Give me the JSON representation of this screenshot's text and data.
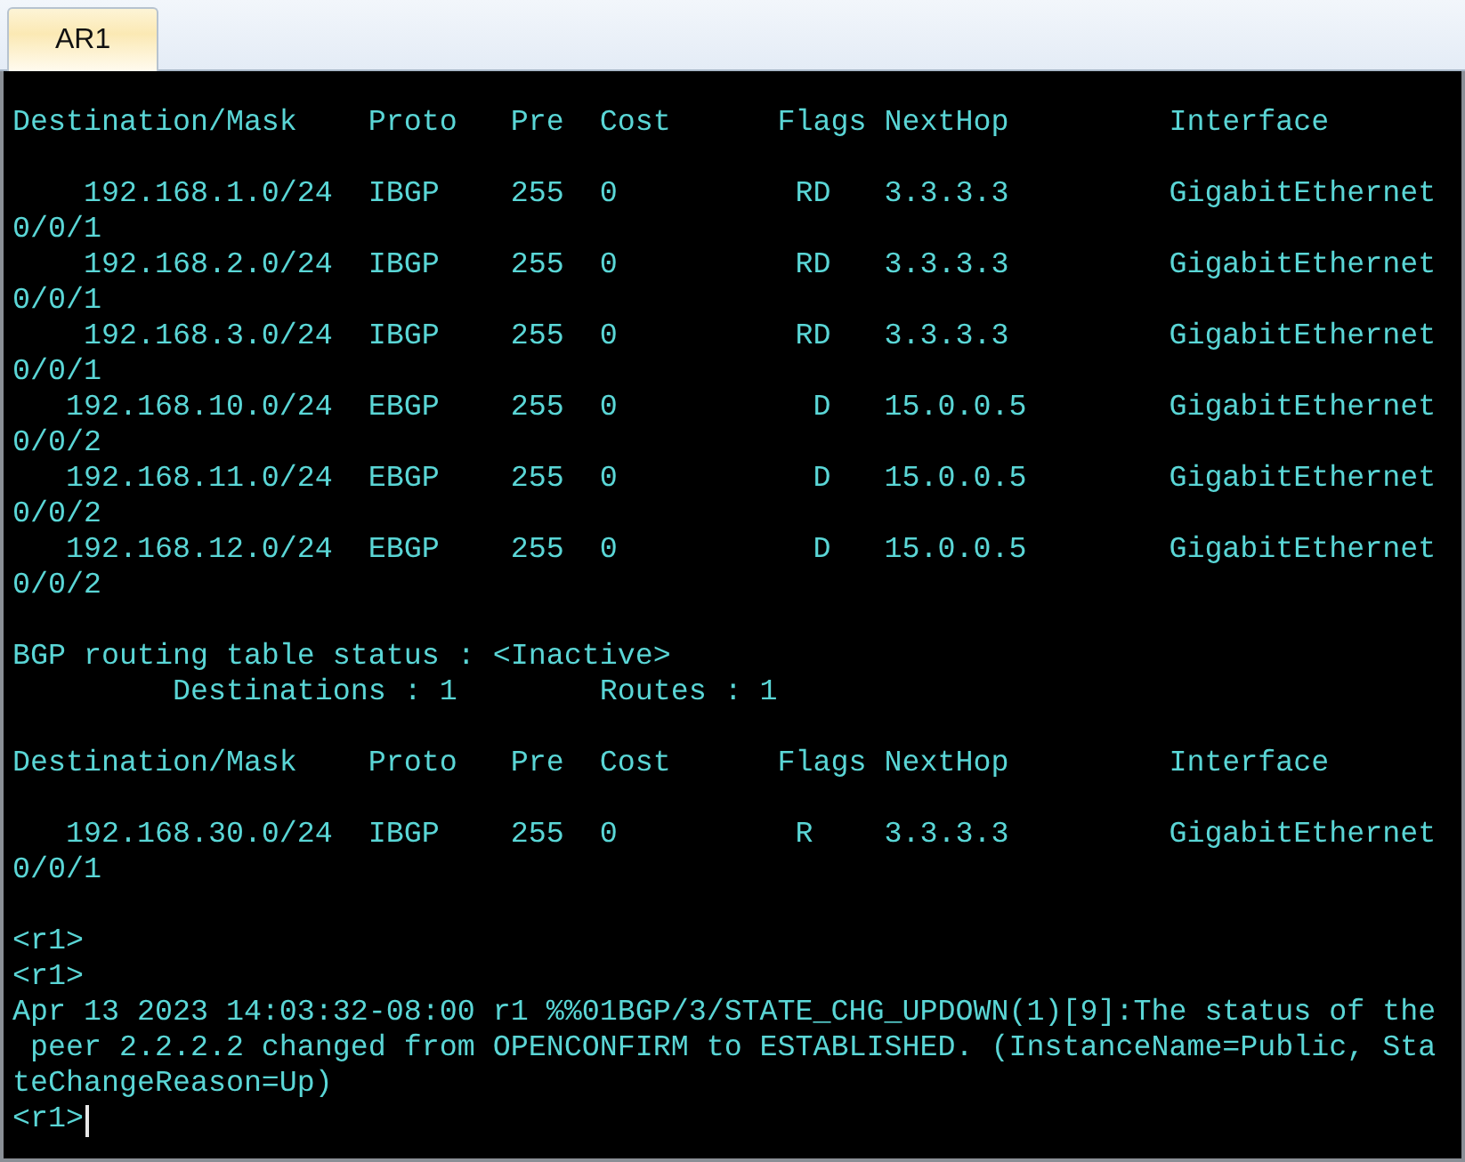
{
  "tabs": [
    {
      "label": "AR1",
      "selected": true
    }
  ],
  "terminal": {
    "cursor": true,
    "blocks": [
      [
        "Destination/Mask    Proto   Pre  Cost      Flags NextHop         Interface"
      ],
      [
        "    192.168.1.0/24  IBGP    255  0          RD   3.3.3.3         GigabitEthernet",
        "0/0/1",
        "    192.168.2.0/24  IBGP    255  0          RD   3.3.3.3         GigabitEthernet",
        "0/0/1",
        "    192.168.3.0/24  IBGP    255  0          RD   3.3.3.3         GigabitEthernet",
        "0/0/1",
        "   192.168.10.0/24  EBGP    255  0           D   15.0.0.5        GigabitEthernet",
        "0/0/2",
        "   192.168.11.0/24  EBGP    255  0           D   15.0.0.5        GigabitEthernet",
        "0/0/2",
        "   192.168.12.0/24  EBGP    255  0           D   15.0.0.5        GigabitEthernet",
        "0/0/2"
      ],
      [
        "BGP routing table status : <Inactive>",
        "         Destinations : 1        Routes : 1"
      ],
      [
        "Destination/Mask    Proto   Pre  Cost      Flags NextHop         Interface"
      ],
      [
        "   192.168.30.0/24  IBGP    255  0          R    3.3.3.3         GigabitEthernet",
        "0/0/1"
      ],
      [
        "<r1>",
        "<r1>",
        "Apr 13 2023 14:03:32-08:00 r1 %%01BGP/3/STATE_CHG_UPDOWN(1)[9]:The status of the",
        " peer 2.2.2.2 changed from OPENCONFIRM to ESTABLISHED. (InstanceName=Public, Sta",
        "teChangeReason=Up)",
        "<r1>"
      ]
    ]
  }
}
